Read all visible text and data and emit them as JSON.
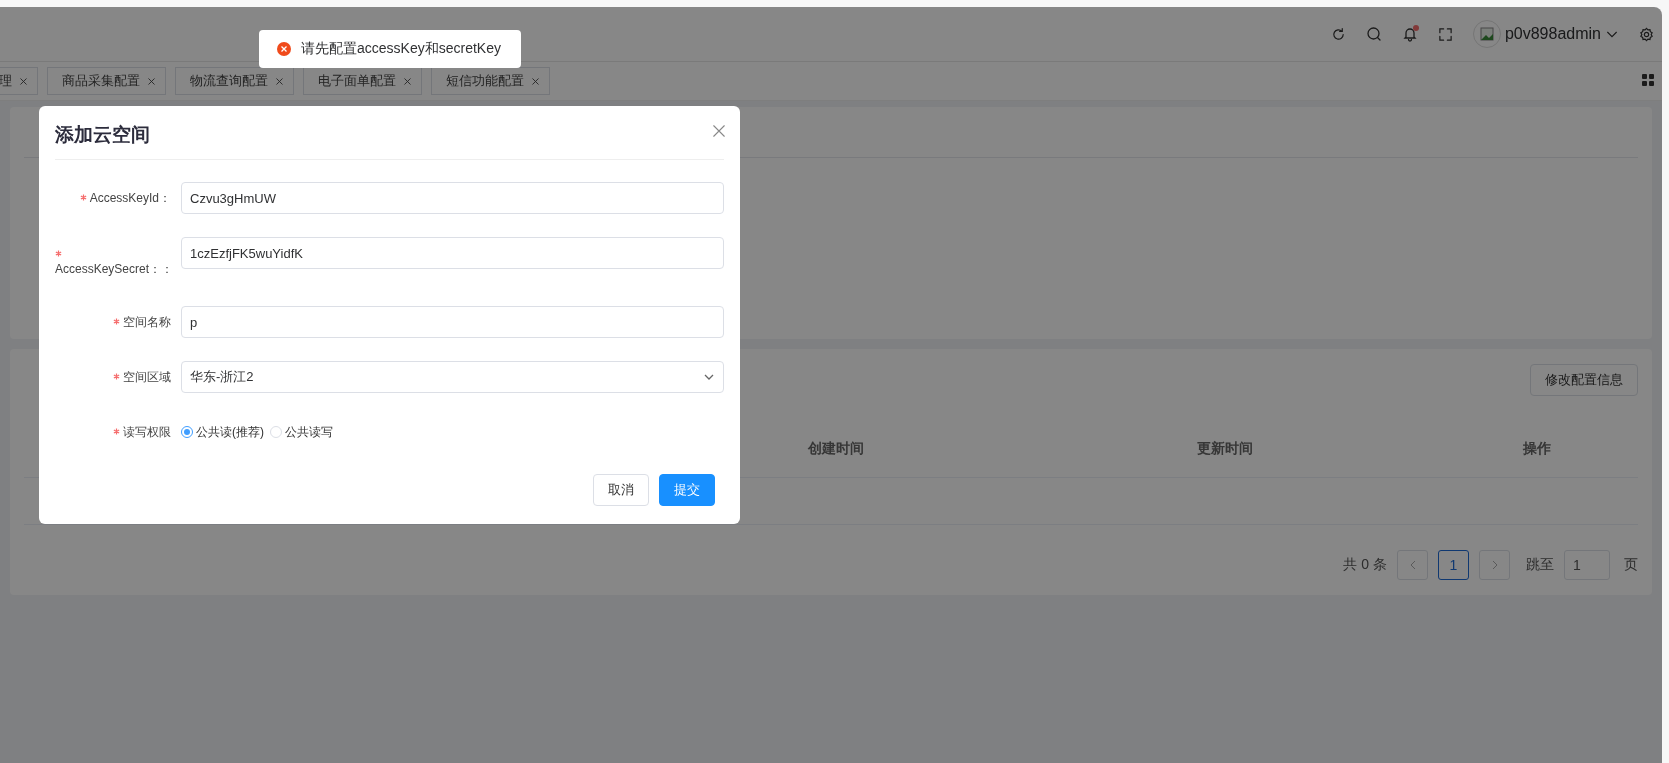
{
  "header": {
    "username": "p0v898admin",
    "has_unread_notifications": true
  },
  "tabs": [
    {
      "label": "理",
      "selected": false
    },
    {
      "label": "商品采集配置",
      "selected": false
    },
    {
      "label": "物流查询配置",
      "selected": false
    },
    {
      "label": "电子面单配置",
      "selected": false
    },
    {
      "label": "短信功能配置",
      "selected": false
    }
  ],
  "toolbar": {
    "edit_button": "修改配置信息"
  },
  "table": {
    "columns": [
      "创建时间",
      "更新时间",
      "操作"
    ]
  },
  "pagination": {
    "total": "共 0 条",
    "pages": [
      {
        "label": "1",
        "selected": true
      }
    ],
    "jump_label": "跳至",
    "jump_value": "1",
    "jump_suffix": "页"
  },
  "message": {
    "kind": "error",
    "text": "请先配置accessKey和secretKey"
  },
  "dialog": {
    "title": "添加云空间",
    "fields": [
      {
        "kind": "text",
        "label": "AccessKeyId：",
        "required": true,
        "value": "Czvu3gHmUW"
      },
      {
        "kind": "text",
        "label": "AccessKeySecret：：",
        "required": true,
        "value": "1czEzfjFK5wuYidfK"
      },
      {
        "kind": "text",
        "label": "空间名称",
        "required": true,
        "value": "p"
      },
      {
        "kind": "select",
        "label": "空间区域",
        "required": true,
        "value": "华东-浙江2"
      },
      {
        "kind": "radio",
        "label": "读写权限",
        "required": true,
        "options": [
          {
            "label": "公共读(推荐)",
            "selected": true
          },
          {
            "label": "公共读写",
            "selected": false
          }
        ]
      }
    ],
    "buttons": [
      {
        "label": "取消",
        "kind": "default"
      },
      {
        "label": "提交",
        "kind": "primary"
      }
    ]
  }
}
